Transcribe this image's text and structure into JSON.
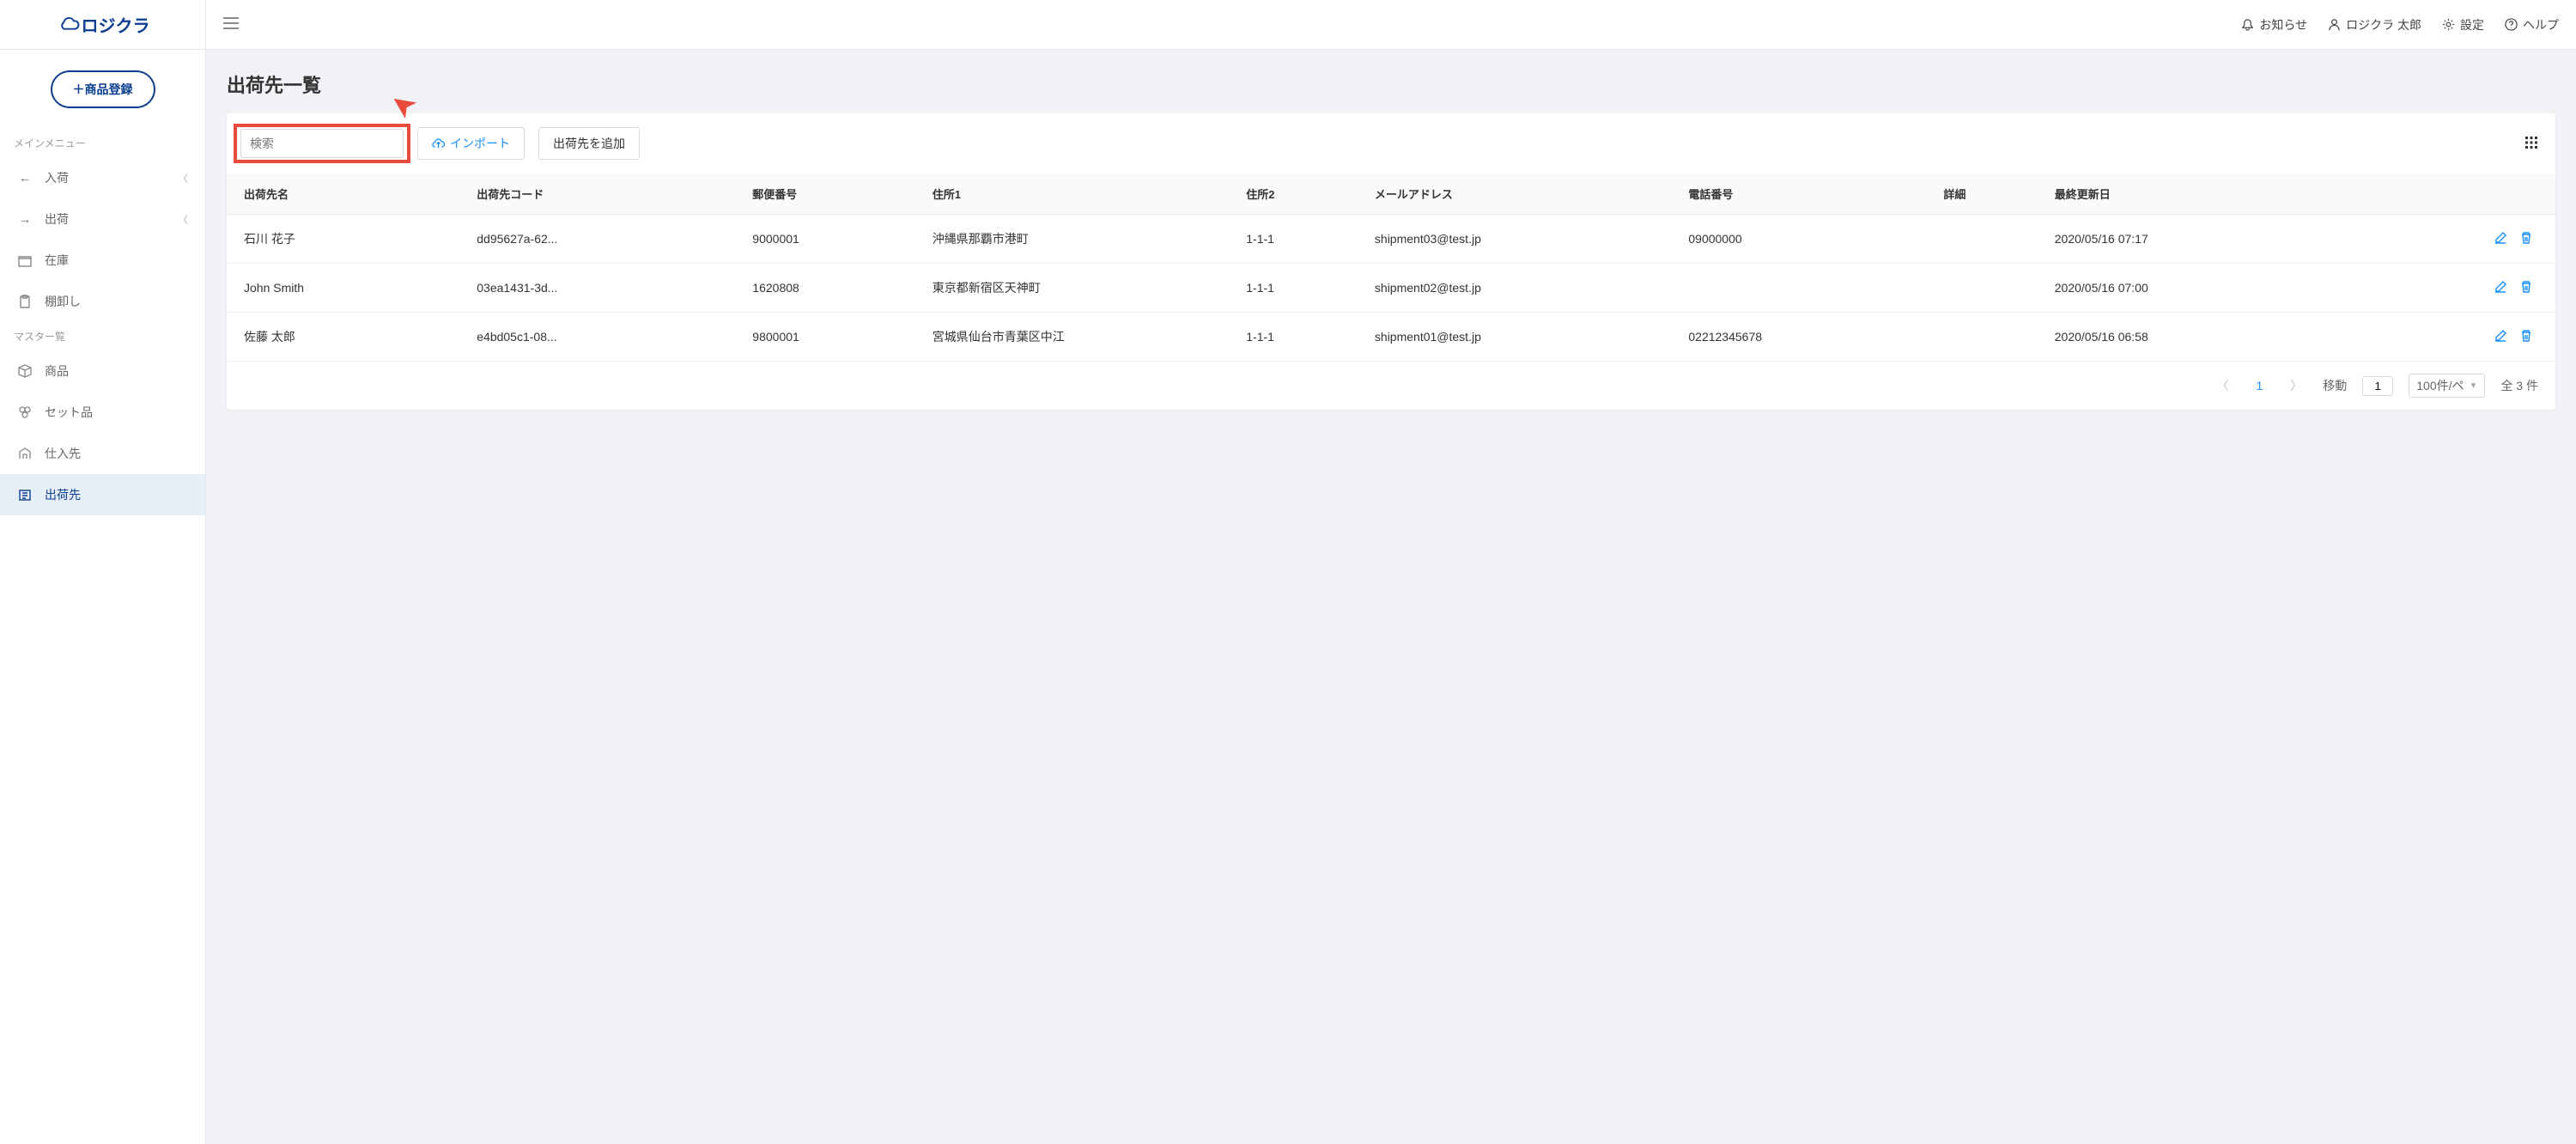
{
  "brand": "ロジクラ",
  "register_button": "＋商品登録",
  "nav": {
    "main_title": "メインメニュー",
    "items_main": [
      {
        "icon": "arrow-left",
        "label": "入荷",
        "expandable": true
      },
      {
        "icon": "arrow-right",
        "label": "出荷",
        "expandable": true
      },
      {
        "icon": "inventory",
        "label": "在庫",
        "expandable": false
      },
      {
        "icon": "clipboard",
        "label": "棚卸し",
        "expandable": false
      }
    ],
    "master_title": "マスター覧",
    "items_master": [
      {
        "icon": "box",
        "label": "商品"
      },
      {
        "icon": "pieces",
        "label": "セット品"
      },
      {
        "icon": "supplier",
        "label": "仕入先"
      },
      {
        "icon": "dest",
        "label": "出荷先",
        "active": true
      }
    ]
  },
  "topbar": {
    "notice": "お知らせ",
    "user": "ロジクラ 太郎",
    "settings": "設定",
    "help": "ヘルプ"
  },
  "page": {
    "title": "出荷先一覧",
    "search_placeholder": "検索",
    "import_label": "インポート",
    "add_label": "出荷先を追加"
  },
  "table": {
    "columns": [
      "出荷先名",
      "出荷先コード",
      "郵便番号",
      "住所1",
      "住所2",
      "メールアドレス",
      "電話番号",
      "詳細",
      "最終更新日"
    ],
    "rows": [
      {
        "name": "石川 花子",
        "code": "dd95627a-62...",
        "zip": "9000001",
        "addr1": "沖縄県那覇市港町",
        "addr2": "1-1-1",
        "email": "shipment03@test.jp",
        "phone": "09000000",
        "detail": "",
        "updated": "2020/05/16 07:17"
      },
      {
        "name": "John Smith",
        "code": "03ea1431-3d...",
        "zip": "1620808",
        "addr1": "東京都新宿区天神町",
        "addr2": "1-1-1",
        "email": "shipment02@test.jp",
        "phone": "",
        "detail": "",
        "updated": "2020/05/16 07:00"
      },
      {
        "name": "佐藤 太郎",
        "code": "e4bd05c1-08...",
        "zip": "9800001",
        "addr1": "宮城県仙台市青葉区中江",
        "addr2": "1-1-1",
        "email": "shipment01@test.jp",
        "phone": "02212345678",
        "detail": "",
        "updated": "2020/05/16 06:58"
      }
    ]
  },
  "pagination": {
    "current": "1",
    "move_label": "移動",
    "move_value": "1",
    "per_page": "100件/ペ",
    "total": "全 3 件"
  }
}
